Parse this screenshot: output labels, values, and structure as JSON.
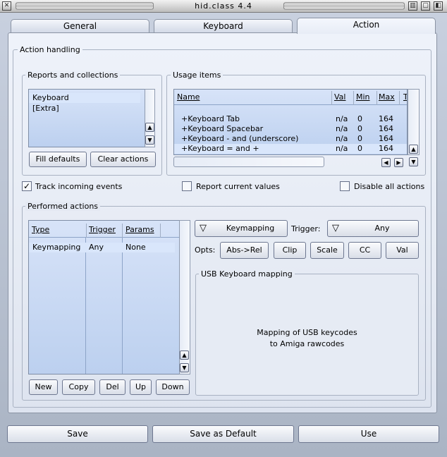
{
  "window": {
    "title": "hid.class 4.4"
  },
  "tabs": [
    {
      "label": "General"
    },
    {
      "label": "Keyboard"
    },
    {
      "label": "Action"
    }
  ],
  "action_handling": {
    "label": "Action handling",
    "reports": {
      "label": "Reports and collections",
      "items": [
        "Keyboard",
        "[Extra]"
      ],
      "fill_defaults": "Fill defaults",
      "clear_actions": "Clear actions"
    },
    "usage": {
      "label": "Usage items",
      "headers": {
        "name": "Name",
        "val": "Val",
        "min": "Min",
        "max": "Max",
        "t": "T"
      },
      "rows": [
        {
          "name": "+Keyboard Tab",
          "val": "n/a",
          "min": "0",
          "max": "164"
        },
        {
          "name": "+Keyboard Spacebar",
          "val": "n/a",
          "min": "0",
          "max": "164"
        },
        {
          "name": "+Keyboard - and (underscore)",
          "val": "n/a",
          "min": "0",
          "max": "164"
        },
        {
          "name": "+Keyboard = and +",
          "val": "n/a",
          "min": "0",
          "max": "164"
        }
      ]
    },
    "track_incoming": "Track incoming events",
    "report_current": "Report current values",
    "disable_all": "Disable all actions"
  },
  "performed": {
    "label": "Performed actions",
    "headers": {
      "type": "Type",
      "trigger": "Trigger",
      "params": "Params"
    },
    "rows": [
      {
        "type": "Keymapping",
        "trigger": "Any",
        "params": "None"
      }
    ],
    "buttons": {
      "new": "New",
      "copy": "Copy",
      "del": "Del",
      "up": "Up",
      "down": "Down"
    },
    "action_type": "Keymapping",
    "trigger_label": "Trigger:",
    "trigger_value": "Any",
    "opts_label": "Opts:",
    "opts": {
      "absrel": "Abs->Rel",
      "clip": "Clip",
      "scale": "Scale",
      "cc": "CC",
      "val": "Val"
    },
    "mapping": {
      "label": "USB Keyboard mapping",
      "line1": "Mapping of USB keycodes",
      "line2": "to Amiga rawcodes"
    }
  },
  "bottom": {
    "save": "Save",
    "save_default": "Save as Default",
    "use": "Use"
  },
  "state": {
    "track_incoming": true,
    "report_current": false,
    "disable_all": false
  }
}
